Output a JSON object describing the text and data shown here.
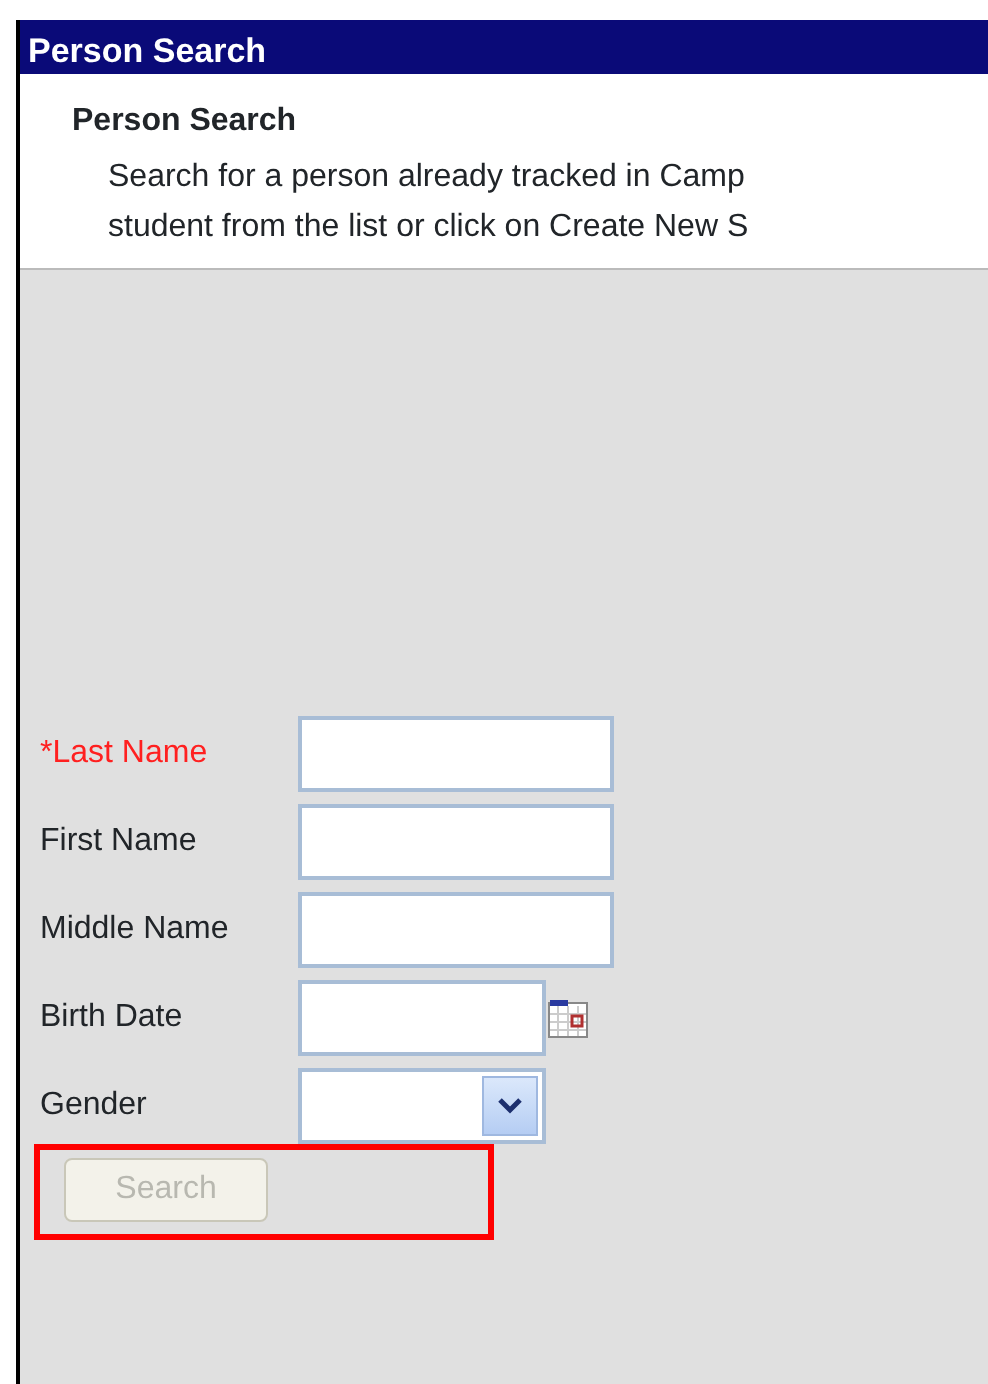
{
  "window": {
    "title": "Person Search"
  },
  "header": {
    "heading": "Person Search",
    "lines": [
      "Search for a person already tracked in Camp",
      "student from the list or click on Create New S"
    ]
  },
  "fields": [
    {
      "label": "*Last Name",
      "kind": "text",
      "required": true
    },
    {
      "label": "First Name",
      "kind": "text",
      "required": false
    },
    {
      "label": "Middle Name",
      "kind": "text",
      "required": false
    },
    {
      "label": "Birth Date",
      "kind": "date",
      "required": false
    },
    {
      "label": "Gender",
      "kind": "select",
      "required": false
    }
  ],
  "search_button": {
    "label": "Search",
    "disabled": true,
    "highlighted": true
  }
}
